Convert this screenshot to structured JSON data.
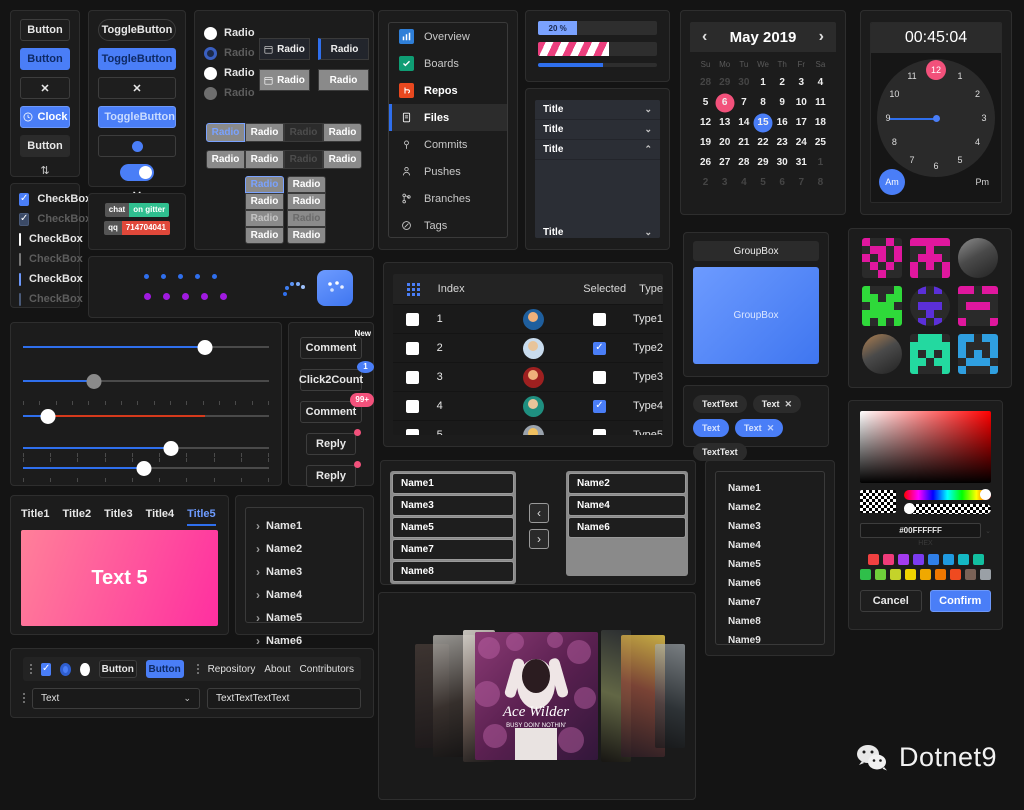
{
  "meta": {
    "background": "#141414",
    "accent": "#4a7ef7",
    "pink": "#f2517b"
  },
  "buttons_panel": {
    "items": [
      {
        "label": "Button",
        "style": "outline"
      },
      {
        "label": "Button",
        "style": "accent"
      },
      {
        "label": "✕",
        "style": "outline-icon"
      },
      {
        "label": "Clock",
        "style": "accent-icon",
        "icon": "clock-icon"
      },
      {
        "label": "Button",
        "style": "flat"
      },
      {
        "label": "⇅",
        "style": "spinner-icon"
      }
    ]
  },
  "toggle_panel": {
    "items": [
      {
        "label": "ToggleButton",
        "style": "outline-pill"
      },
      {
        "label": "ToggleButton",
        "style": "accent"
      },
      {
        "label": "✕",
        "style": "outline-icon"
      },
      {
        "label": "ToggleButton",
        "style": "accent-icon",
        "icon": "clock-icon"
      },
      {
        "label": "",
        "style": "switch-off"
      },
      {
        "label": "",
        "style": "switch-on"
      },
      {
        "label": "✕",
        "style": "bare-icon"
      }
    ]
  },
  "checkbox_panel": {
    "items": [
      {
        "label": "CheckBox",
        "state": "checked",
        "variant": "accent"
      },
      {
        "label": "CheckBox",
        "state": "checked-disabled",
        "variant": "dim"
      },
      {
        "label": "CheckBox",
        "state": "checked",
        "variant": "white"
      },
      {
        "label": "CheckBox",
        "state": "checked-disabled",
        "variant": "grey"
      },
      {
        "label": "CheckBox",
        "state": "checked",
        "variant": "lblue"
      },
      {
        "label": "CheckBox",
        "state": "checked-disabled",
        "variant": "dim2"
      }
    ]
  },
  "shields": [
    {
      "left": "chat",
      "right": "on gitter",
      "color": "#2fbf8f"
    },
    {
      "left": "qq",
      "right": "714704041",
      "color": "#e0483a"
    }
  ],
  "radio_panel": {
    "plain": [
      {
        "label": "Radio",
        "state": "on"
      },
      {
        "label": "Radio",
        "state": "selected-dim"
      },
      {
        "label": "Radio",
        "state": "on"
      },
      {
        "label": "Radio",
        "state": "off"
      }
    ],
    "boxed_row1": [
      {
        "label": "Radio",
        "icon": "calendar-icon",
        "style": "dark"
      },
      {
        "label": "Radio",
        "style": "dark-bar"
      }
    ],
    "boxed_row2": [
      {
        "label": "Radio",
        "icon": "calendar-icon",
        "style": "grey"
      },
      {
        "label": "Radio",
        "style": "grey"
      }
    ],
    "group_a": [
      {
        "label": "Radio",
        "style": "active"
      },
      {
        "label": "Radio",
        "style": "grey"
      },
      {
        "label": "Radio",
        "style": "faint"
      },
      {
        "label": "Radio",
        "style": "grey"
      }
    ],
    "group_b": [
      {
        "label": "Radio",
        "style": "grey"
      },
      {
        "label": "Radio",
        "style": "grey"
      },
      {
        "label": "Radio",
        "style": "faint"
      },
      {
        "label": "Radio",
        "style": "grey"
      }
    ],
    "col_a": [
      {
        "label": "Radio",
        "style": "active"
      },
      {
        "label": "Radio",
        "style": "grey"
      },
      {
        "label": "Radio",
        "style": "faint"
      },
      {
        "label": "Radio",
        "style": "grey"
      }
    ],
    "col_b": [
      {
        "label": "Radio",
        "style": "greyd"
      },
      {
        "label": "Radio",
        "style": "greyd"
      },
      {
        "label": "Radio",
        "style": "faint"
      },
      {
        "label": "Radio",
        "style": "greyd"
      }
    ]
  },
  "nav_menu": {
    "items": [
      {
        "label": "Overview",
        "icon": "overview-icon",
        "color": "#2f7fd8",
        "state": "normal"
      },
      {
        "label": "Boards",
        "icon": "boards-icon",
        "color": "#0f9d74",
        "state": "normal"
      },
      {
        "label": "Repos",
        "icon": "repos-icon",
        "color": "#e8481f",
        "state": "bold"
      },
      {
        "label": "Files",
        "icon": "files-icon",
        "color": "",
        "state": "active"
      },
      {
        "label": "Commits",
        "icon": "commit-icon",
        "color": "",
        "state": "normal"
      },
      {
        "label": "Pushes",
        "icon": "push-icon",
        "color": "",
        "state": "normal"
      },
      {
        "label": "Branches",
        "icon": "branch-icon",
        "color": "",
        "state": "normal"
      },
      {
        "label": "Tags",
        "icon": "tag-icon",
        "color": "",
        "state": "normal"
      }
    ]
  },
  "progress": {
    "labelled": {
      "value": 20,
      "text": "20 %"
    },
    "striped": {
      "value": 60
    },
    "thin": {
      "value": 55
    }
  },
  "expander": {
    "items": [
      {
        "title": "Title",
        "open": false
      },
      {
        "title": "Title",
        "open": false
      },
      {
        "title": "Title",
        "open": true
      },
      {
        "title": "Title",
        "open": false
      }
    ],
    "chevron_closed": "⌄",
    "chevron_open": "⌃"
  },
  "calendar": {
    "title": "May 2019",
    "prev": "‹",
    "next": "›",
    "dow": [
      "Su",
      "Mo",
      "Tu",
      "We",
      "Th",
      "Fr",
      "Sa"
    ],
    "cells": [
      {
        "d": "28",
        "o": true
      },
      {
        "d": "29",
        "o": true
      },
      {
        "d": "30",
        "o": true
      },
      {
        "d": "1"
      },
      {
        "d": "2"
      },
      {
        "d": "3"
      },
      {
        "d": "4"
      },
      {
        "d": "5"
      },
      {
        "d": "6",
        "mark": "pink"
      },
      {
        "d": "7"
      },
      {
        "d": "8"
      },
      {
        "d": "9"
      },
      {
        "d": "10"
      },
      {
        "d": "11"
      },
      {
        "d": "12"
      },
      {
        "d": "13"
      },
      {
        "d": "14"
      },
      {
        "d": "15",
        "mark": "blue"
      },
      {
        "d": "16"
      },
      {
        "d": "17"
      },
      {
        "d": "18"
      },
      {
        "d": "19"
      },
      {
        "d": "20"
      },
      {
        "d": "21"
      },
      {
        "d": "22"
      },
      {
        "d": "23"
      },
      {
        "d": "24"
      },
      {
        "d": "25"
      },
      {
        "d": "26"
      },
      {
        "d": "27"
      },
      {
        "d": "28"
      },
      {
        "d": "29"
      },
      {
        "d": "30"
      },
      {
        "d": "31"
      },
      {
        "d": "1",
        "o": true
      },
      {
        "d": "2",
        "o": true
      },
      {
        "d": "3",
        "o": true
      },
      {
        "d": "4",
        "o": true
      },
      {
        "d": "5",
        "o": true
      },
      {
        "d": "6",
        "o": true
      },
      {
        "d": "7",
        "o": true
      },
      {
        "d": "8",
        "o": true
      }
    ]
  },
  "clock": {
    "time": "00:45:04",
    "numbers": [
      "12",
      "1",
      "2",
      "3",
      "4",
      "5",
      "6",
      "7",
      "8",
      "9",
      "10",
      "11"
    ],
    "highlighted": "12",
    "hand_points_to": "9",
    "am_label": "Am",
    "pm_label": "Pm",
    "am_active": true
  },
  "table": {
    "headers": {
      "grid": "grid-icon",
      "index": "Index",
      "avatar": "",
      "selected": "Selected",
      "type": "Type"
    },
    "rows": [
      {
        "index": "1",
        "checked": false,
        "selected": false,
        "type": "Type1",
        "avatar": "#1f5f9e",
        "face": "#f0b07a"
      },
      {
        "index": "2",
        "checked": false,
        "selected": true,
        "type": "Type2",
        "avatar": "#c9dcee",
        "face": "#e8c49a"
      },
      {
        "index": "3",
        "checked": false,
        "selected": false,
        "type": "Type3",
        "avatar": "#9e2020",
        "face": "#f0b07a"
      },
      {
        "index": "4",
        "checked": false,
        "selected": true,
        "type": "Type4",
        "avatar": "#1f8f80",
        "face": "#e8c49a"
      },
      {
        "index": "5",
        "checked": false,
        "selected": false,
        "type": "Type5",
        "avatar": "#9aa3ad",
        "face": "#f0c060"
      }
    ]
  },
  "sliders": [
    {
      "value": 74,
      "thumb": "white",
      "fill": "blue",
      "ticks": "none"
    },
    {
      "value": 29,
      "thumb": "grey",
      "fill": "blue",
      "ticks": "none"
    },
    {
      "value": 10,
      "thumb": "white",
      "fill": "red",
      "ticks": "top"
    },
    {
      "value": 60,
      "thumb": "white",
      "fill": "blue",
      "ticks": "bottom"
    },
    {
      "value": 49,
      "thumb": "white",
      "fill": "blue",
      "ticks": "both"
    }
  ],
  "badges": [
    {
      "label": "Comment",
      "badge": "New",
      "style": "plain"
    },
    {
      "label": "Click2Count",
      "badge": "1",
      "style": "blue"
    },
    {
      "label": "Comment",
      "badge": "99+",
      "style": "pink"
    },
    {
      "label": "Reply",
      "badge": "",
      "style": "dot"
    },
    {
      "label": "Reply",
      "badge": "",
      "style": "dot"
    }
  ],
  "tabs": {
    "items": [
      "Title1",
      "Title2",
      "Title3",
      "Title4",
      "Title5"
    ],
    "active": "Title5",
    "content": "Text 5"
  },
  "tree": {
    "items": [
      "Name1",
      "Name2",
      "Name3",
      "Name4",
      "Name5",
      "Name6"
    ]
  },
  "transfer": {
    "left": [
      "Name1",
      "Name3",
      "Name5",
      "Name7",
      "Name8"
    ],
    "right": [
      "Name2",
      "Name4",
      "Name6"
    ],
    "to_left": "‹",
    "to_right": "›"
  },
  "name_list": {
    "items": [
      "Name1",
      "Name2",
      "Name3",
      "Name4",
      "Name5",
      "Name6",
      "Name7",
      "Name8",
      "Name9"
    ]
  },
  "groupbox": {
    "header": "GroupBox",
    "body": "GroupBox"
  },
  "tags": [
    {
      "label": "TextText",
      "closable": false,
      "style": "dark"
    },
    {
      "label": "Text",
      "closable": true,
      "style": "dark"
    },
    {
      "label": "Text",
      "closable": false,
      "style": "blue"
    },
    {
      "label": "Text",
      "closable": true,
      "style": "blue"
    },
    {
      "label": "TextText",
      "closable": false,
      "style": "dark"
    }
  ],
  "avatars_grid": [
    {
      "kind": "pixel",
      "color": "#e0179e",
      "pattern": "heart"
    },
    {
      "kind": "pixel",
      "color": "#e0179e",
      "pattern": "robot"
    },
    {
      "kind": "photo",
      "color": "#8e8e8e",
      "shape": "round"
    },
    {
      "kind": "pixel",
      "color": "#2fd93a",
      "pattern": "creeper"
    },
    {
      "kind": "pixel",
      "color": "#5b2fd9",
      "pattern": "face",
      "shape": "round"
    },
    {
      "kind": "pixel",
      "color": "#e0179e",
      "pattern": "blocks"
    },
    {
      "kind": "photo",
      "color": "#b08050",
      "shape": "round"
    },
    {
      "kind": "pixel",
      "color": "#23d9a0",
      "pattern": "invader"
    },
    {
      "kind": "pixel",
      "color": "#2f9fe0",
      "pattern": "glyph"
    }
  ],
  "color_picker": {
    "hex": "#00FFFFFF",
    "hex_label": "HEX",
    "cancel": "Cancel",
    "confirm": "Confirm",
    "swatches_row1": [
      "#f04141",
      "#ef3b7a",
      "#a33bef",
      "#7b3bef",
      "#2f7fe8",
      "#1f9ae0",
      "#14b8c4",
      "#12bfa0"
    ],
    "swatches_row2": [
      "#2fbf4a",
      "#6fcf3a",
      "#c4d32a",
      "#f0d400",
      "#f0a800",
      "#f07800",
      "#ef4a20",
      "#7a6257",
      "#9aa0a6"
    ]
  },
  "bottom_bar": {
    "checkbox_checked": true,
    "radio_blue": true,
    "radio_white": true,
    "button1": "Button",
    "button2": "Button",
    "menu": [
      "Repository",
      "About",
      "Contributors"
    ],
    "combo_value": "Text",
    "text_value": "TextTextTextText"
  },
  "carousel": {
    "center_title": "Ace Wilder",
    "center_subtitle": "BUSY DOIN' NOTHIN'"
  },
  "footer": {
    "logo_text": "Dotnet9",
    "logo_icon": "wechat-icon"
  },
  "loading": {
    "dots_blue": 5,
    "dots_purple": 5
  }
}
